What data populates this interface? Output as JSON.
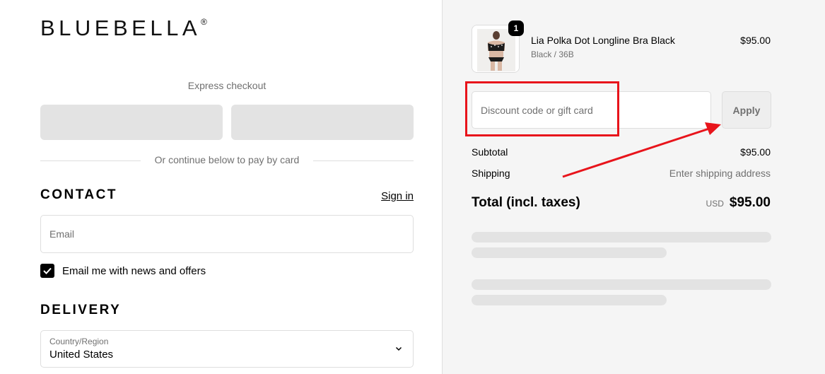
{
  "brand": {
    "logo_text": "BLUEBELLA",
    "logo_mark": "®"
  },
  "express": {
    "label": "Express checkout",
    "divider_text": "Or continue below to pay by card"
  },
  "contact": {
    "title": "CONTACT",
    "sign_in": "Sign in",
    "email_placeholder": "Email",
    "newsletter_label": "Email me with news and offers",
    "newsletter_checked": true
  },
  "delivery": {
    "title": "DELIVERY",
    "country_label": "Country/Region",
    "country_value": "United States"
  },
  "order": {
    "item": {
      "quantity": "1",
      "name": "Lia Polka Dot Longline Bra Black",
      "variant": "Black / 36B",
      "price": "$95.00"
    },
    "discount_placeholder": "Discount code or gift card",
    "apply_label": "Apply",
    "subtotal_label": "Subtotal",
    "subtotal_value": "$95.00",
    "shipping_label": "Shipping",
    "shipping_value": "Enter shipping address",
    "total_label": "Total (incl. taxes)",
    "total_currency": "USD",
    "total_value": "$95.00"
  },
  "colors": {
    "annotation": "#e8141b",
    "sidebar_bg": "#f5f5f5",
    "skeleton": "#e3e3e3",
    "muted_text": "#707070"
  },
  "icons": {
    "checkbox": "check-icon",
    "country": "chevron-down-icon",
    "annotation": "arrow-icon"
  }
}
